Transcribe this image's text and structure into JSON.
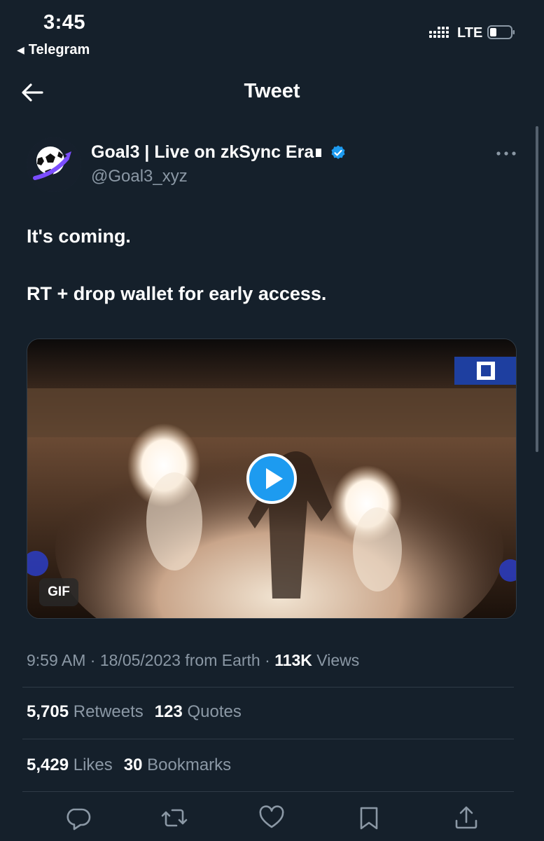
{
  "status_bar": {
    "time": "3:45",
    "back_app": "Telegram",
    "network": "LTE"
  },
  "nav": {
    "title": "Tweet",
    "back_icon": "arrow-left-icon"
  },
  "author": {
    "display_name": "Goal3 | Live on zkSync Era",
    "handle": "@Goal3_xyz",
    "verified": true,
    "verified_color": "#1d9bf0"
  },
  "tweet": {
    "line1": "It's coming.",
    "line2": "RT + drop wallet for early access."
  },
  "media": {
    "badge": "GIF",
    "play_icon": "play-icon"
  },
  "meta": {
    "time": "9:59 AM",
    "date": "18/05/2023",
    "source": "from Earth",
    "views_count": "113K",
    "views_label": "Views"
  },
  "stats": {
    "retweets_count": "5,705",
    "retweets_label": "Retweets",
    "quotes_count": "123",
    "quotes_label": "Quotes",
    "likes_count": "5,429",
    "likes_label": "Likes",
    "bookmarks_count": "30",
    "bookmarks_label": "Bookmarks"
  },
  "actions": [
    "reply-icon",
    "retweet-icon",
    "like-icon",
    "bookmark-icon",
    "share-icon"
  ],
  "colors": {
    "background": "#15202b",
    "secondary_text": "#8b98a5",
    "accent": "#1d9bf0"
  }
}
